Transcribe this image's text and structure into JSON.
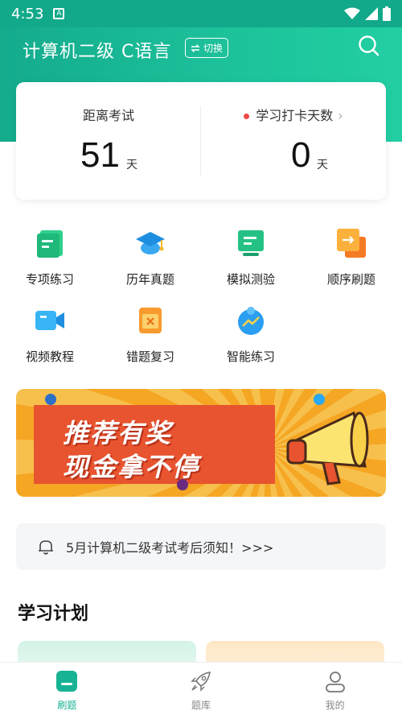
{
  "status_bar": {
    "time": "4:53",
    "notif_glyph": "A"
  },
  "header": {
    "title": "计算机二级 C语言",
    "switch_label": "切换"
  },
  "exam_card": {
    "days_label": "距离考试",
    "days_value": "51",
    "days_unit": "天",
    "checkin_label": "学习打卡天数",
    "checkin_value": "0",
    "checkin_unit": "天"
  },
  "features": [
    {
      "label": "专项练习",
      "icon": "doc-green-icon"
    },
    {
      "label": "历年真题",
      "icon": "graduation-cap-icon"
    },
    {
      "label": "模拟测验",
      "icon": "monitor-icon"
    },
    {
      "label": "顺序刷题",
      "icon": "arrow-card-icon"
    },
    {
      "label": "视频教程",
      "icon": "video-camera-icon"
    },
    {
      "label": "错题复习",
      "icon": "wrong-box-icon"
    },
    {
      "label": "智能练习",
      "icon": "smart-robot-icon"
    }
  ],
  "banner": {
    "line1": "推荐有奖",
    "line2": "现金拿不停"
  },
  "notice": {
    "text": "5月计算机二级考试考后须知！>>>"
  },
  "plan": {
    "title": "学习计划"
  },
  "bottom_nav": [
    {
      "label": "刷题",
      "active": true
    },
    {
      "label": "题库",
      "active": false
    },
    {
      "label": "我的",
      "active": false
    }
  ],
  "colors": {
    "primary": "#18b394",
    "banner_orange": "#e8542f"
  }
}
